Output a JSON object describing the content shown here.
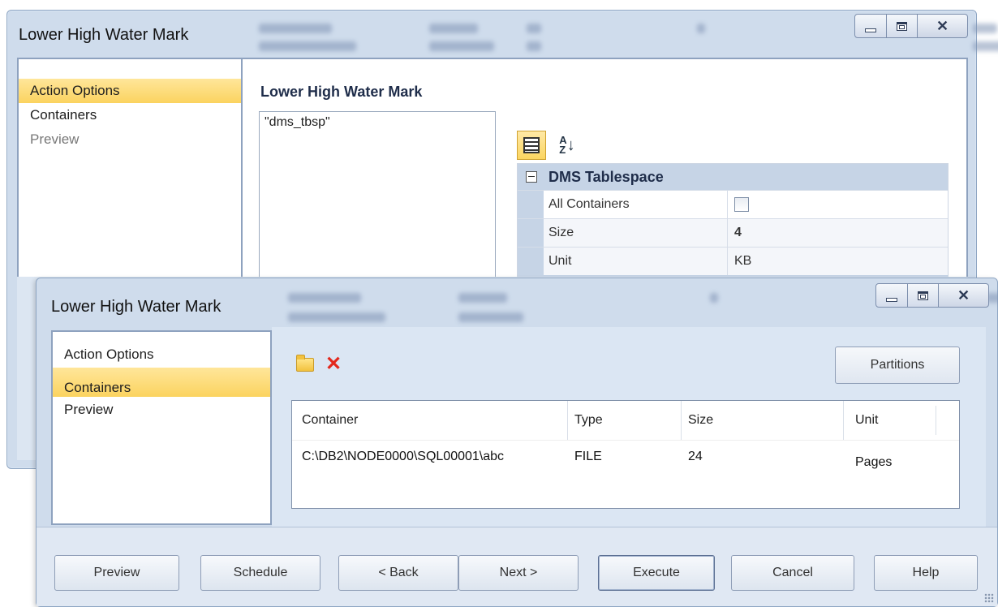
{
  "back_window": {
    "title": "Lower High Water Mark",
    "nav": [
      "Action Options",
      "Containers",
      "Preview"
    ],
    "section_title": "Lower High Water Mark",
    "objects": [
      "\"dms_tbsp\""
    ],
    "property_grid": {
      "category": "DMS Tablespace",
      "rows": [
        {
          "name": "All Containers",
          "value": ""
        },
        {
          "name": "Size",
          "value": "4"
        },
        {
          "name": "Unit",
          "value": "KB"
        }
      ]
    }
  },
  "front_window": {
    "title": "Lower High Water Mark",
    "nav": [
      "Action Options",
      "Containers",
      "Preview"
    ],
    "partitions_label": "Partitions",
    "table": {
      "columns": [
        "Container",
        "Type",
        "Size",
        "Unit"
      ],
      "rows": [
        [
          "C:\\DB2\\NODE0000\\SQL00001\\abc",
          "FILE",
          "24",
          "Pages"
        ]
      ]
    },
    "buttons": [
      "Preview",
      "Schedule",
      "< Back",
      "Next >",
      "Execute",
      "Cancel",
      "Help"
    ]
  },
  "icons": {
    "minimize": "minimize-icon",
    "maximize": "maximize-icon",
    "close": "close-icon",
    "categorized": "categorized-view-icon",
    "alphabetical": "sort-alphabetical-icon",
    "add_container": "folder-add-icon",
    "delete_container": "delete-icon"
  },
  "colors": {
    "selection": "#fbd35f",
    "frame": "#cfdcec",
    "grid_category": "#c6d4e6",
    "delete_red": "#e3281c"
  }
}
